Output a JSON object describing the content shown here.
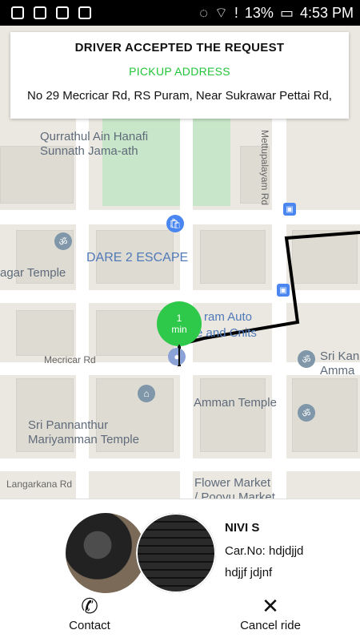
{
  "status_bar": {
    "battery": "13%",
    "time": "4:53 PM"
  },
  "card": {
    "title": "DRIVER ACCEPTED THE REQUEST",
    "label": "PICKUP ADDRESS",
    "address": "No 29 Mecricar Rd, RS Puram, Near Sukrawar Pettai Rd,"
  },
  "map": {
    "labels": {
      "mosque": "Qurrathul Ain Hanafi\nSunnath Jama-ath",
      "dare": "DARE 2 ESCAPE",
      "nagar": "agar Temple",
      "mecricar": "Mecricar Rd",
      "auto_top": "ram Auto",
      "auto_bottom": "e and Cnits",
      "srikan": "Sri Kan\nAmma",
      "amman": "Amman Temple",
      "pannanthur": "Sri Pannanthur\nMariyamman Temple",
      "langarkana": "Langarkana Rd",
      "flower": "Flower Market\n/ Poovu Market",
      "mettupalayam": "Mettupalayam Rd"
    }
  },
  "eta": {
    "value": "1",
    "unit": "min"
  },
  "driver": {
    "name": "NIVI S",
    "car_line1": "Car.No: hdjdjjd",
    "car_line2": "hdjjf jdjnf"
  },
  "actions": {
    "contact": "Contact",
    "cancel": "Cancel ride"
  }
}
